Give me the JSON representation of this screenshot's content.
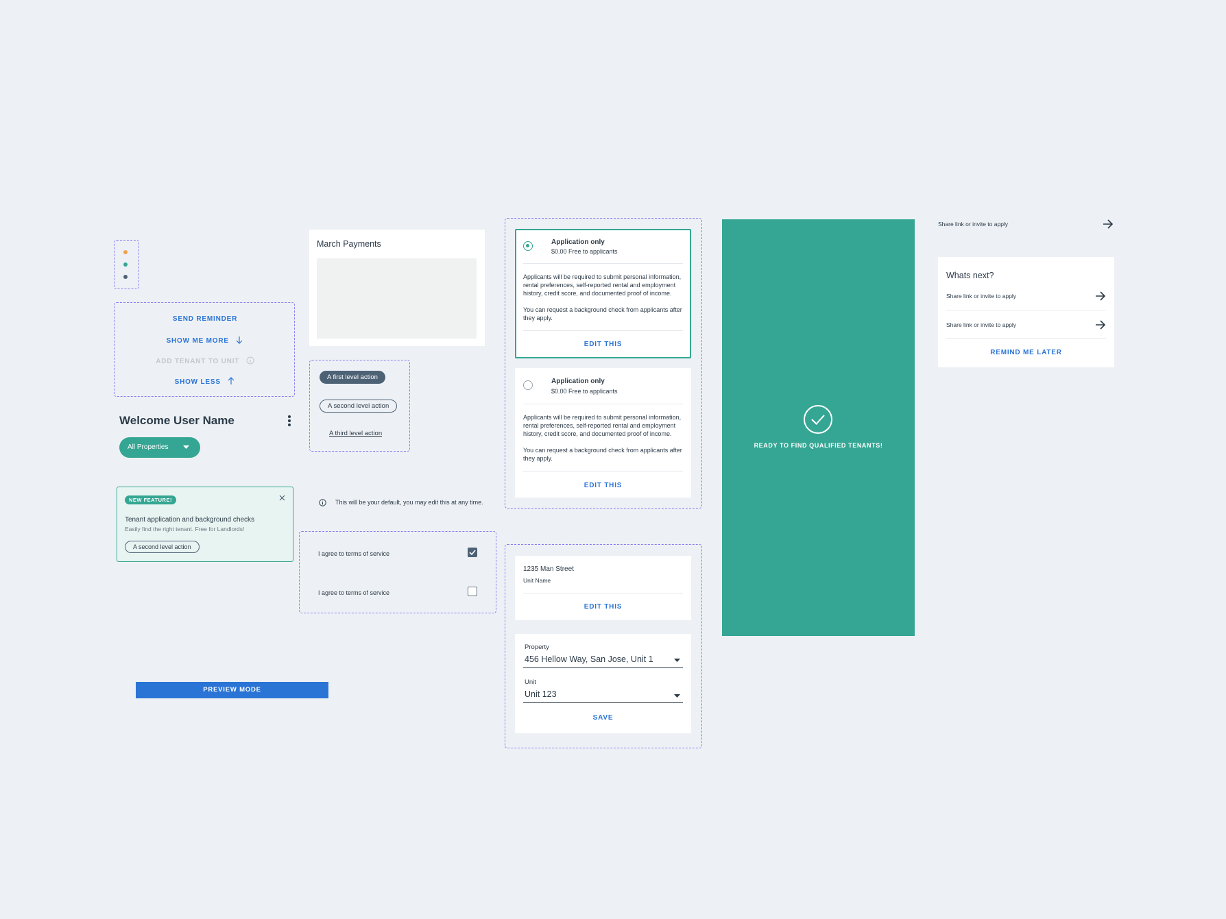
{
  "dots": {
    "colors": [
      "#f0a24c",
      "#35a693",
      "#4e6275"
    ]
  },
  "actions_box": {
    "send_reminder": "SEND REMINDER",
    "show_me_more": "SHOW ME MORE",
    "add_tenant": "ADD TENANT TO UNIT",
    "show_less": "SHOW LESS"
  },
  "welcome": {
    "title": "Welcome User Name",
    "filter_label": "All Properties"
  },
  "feature_banner": {
    "badge": "NEW FEATURE!",
    "title": "Tenant application and background checks",
    "subtitle": "Easily find the right tenant. Free for Landlords!",
    "action": "A second level action"
  },
  "preview": {
    "label": "PREVIEW MODE"
  },
  "payments_card": {
    "title": "March Payments"
  },
  "action_levels": {
    "first": "A first level action",
    "second": "A second level action",
    "third": "A third level action"
  },
  "default_note": {
    "text": "This will be your default, you may edit this at any time."
  },
  "terms": {
    "row1_label": "I agree to terms of service",
    "row1_checked": true,
    "row2_label": "I agree to terms of service",
    "row2_checked": false
  },
  "option_cards": [
    {
      "title": "Application only",
      "price": "$0.00 Free to applicants",
      "body1": "Applicants will be required to submit personal information, rental preferences, self-reported rental and employment history, credit score, and documented proof of income.",
      "body2": "You can request a background check from applicants after they apply.",
      "edit": "EDIT THIS",
      "selected": true
    },
    {
      "title": "Application only",
      "price": "$0.00 Free to applicants",
      "body1": "Applicants will be required to submit personal information, rental preferences, self-reported rental and employment history, credit score, and documented proof of income.",
      "body2": "You can request a background check from applicants after they apply.",
      "edit": "EDIT THIS",
      "selected": false
    }
  ],
  "address_card": {
    "street": "1235 Man Street",
    "unit_name": "Unit Name",
    "edit": "EDIT THIS"
  },
  "property_form": {
    "property_label": "Property",
    "property_value": "456 Hellow Way, San Jose, Unit 1",
    "unit_label": "Unit",
    "unit_value": "Unit 123",
    "save": "SAVE"
  },
  "ready_panel": {
    "text": "READY TO FIND QUALIFIED TENANTS!",
    "color": "#35a693"
  },
  "share_top": {
    "label": "Share link or invite to apply"
  },
  "whats_next": {
    "title": "Whats next?",
    "items": [
      "Share link or invite to apply",
      "Share link or invite to apply"
    ],
    "remind": "REMIND ME LATER"
  }
}
